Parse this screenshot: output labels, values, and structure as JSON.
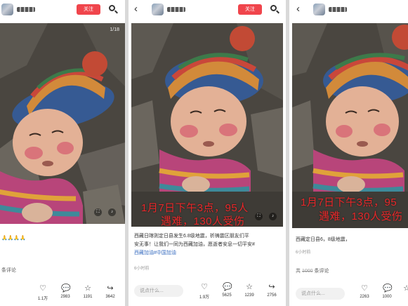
{
  "panel1": {
    "follow_label": "关注",
    "counter": "1/18",
    "caption": "🙏🙏🙏🙏",
    "comments_label": "条评论",
    "actions": {
      "like": "1.1万",
      "comment": "2983",
      "star": "1191",
      "share": "3642"
    }
  },
  "panel2": {
    "follow_label": "关注",
    "overlay_line1": "1月7日下午3点，95人",
    "overlay_line2": "遇难，130人受伤",
    "caption_line1": "西藏日喀则定日县发生6.8级地震，祈祷震区朋友们平",
    "caption_line2": "安无事！让我们一同为西藏加油，愿逝者安息一切平安#",
    "caption_tags": "西藏加油#中国加油",
    "meta": "6小时前",
    "comment_placeholder": "说点什么...",
    "actions": {
      "like": "1.9万",
      "comment": "5625",
      "star": "1239",
      "share": "2756"
    }
  },
  "panel3": {
    "overlay_line1": "1月7日下午3点，95",
    "overlay_line2": "遇难，130人受伤",
    "caption": "西藏定日县6，8级地震，",
    "meta": "6小时前",
    "total_prefix": "共",
    "total_count": "1000",
    "total_suffix": "条评论",
    "comment_placeholder": "说点什么...",
    "actions": {
      "like": "2263",
      "comment": "1000",
      "star": ""
    }
  },
  "colors": {
    "follow_bg": "#f0454c",
    "overlay_text": "#e8282a",
    "tag_link": "#3a6ec0"
  },
  "icons": [
    "back-arrow-icon",
    "search-icon",
    "heart-icon",
    "comment-icon",
    "star-icon",
    "share-icon",
    "screenshot-icon",
    "volume-icon"
  ]
}
